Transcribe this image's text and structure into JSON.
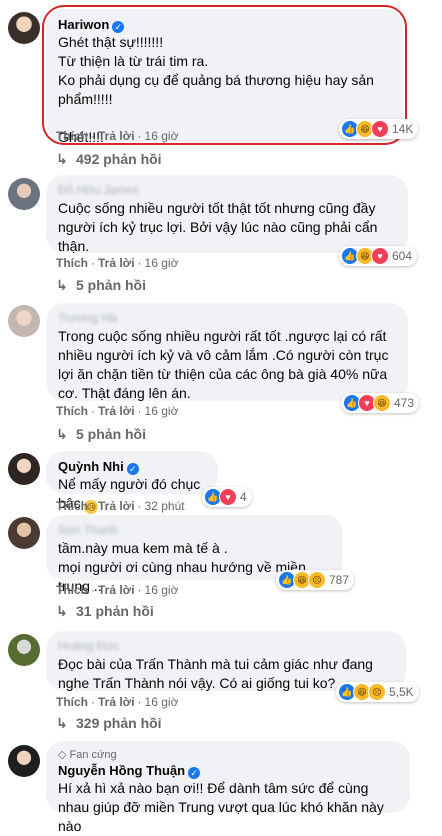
{
  "comments": [
    {
      "name": "Hariwon",
      "text": "Ghét thật sự!!!!!!!\nTừ thiện là từ trái tim ra.\nKo phải dụng cụ để quảng bá thương hiệu hay sản phẩm!!!!!\n\nGhét!!!!",
      "like": "Thích",
      "reply": "Trả lời",
      "time": "16 giờ",
      "reactions_count": "14K",
      "replies": "492 phản hồi"
    },
    {
      "name": "Đỗ Hữu James",
      "text": "Cuộc sống nhiều người tốt thật tốt nhưng cũng đầy người ích kỷ trục lợi. Bởi vậy lúc nào cũng phải cẩn thận.",
      "like": "Thích",
      "reply": "Trả lời",
      "time": "16 giờ",
      "reactions_count": "604",
      "replies": "5 phản hồi"
    },
    {
      "name": "Trương Hà",
      "text": "Trong cuộc sống nhiều người rất tốt .ngược lại có rất nhiều người ích kỷ và vô cảm lắm .Có người còn trục lợi ăn chặn tiền từ thiện của các ông bà già 40% nữa cơ. Thật đáng lên án.",
      "like": "Thích",
      "reply": "Trả lời",
      "time": "16 giờ",
      "reactions_count": "473",
      "replies": "5 phản hồi"
    },
    {
      "name": "Quỳnh Nhi",
      "text": "Nể mấy người đó chục bậc",
      "like": "Thích",
      "reply": "Trả lời",
      "time": "32 phút",
      "reactions_count": "4"
    },
    {
      "name": "Sơn Thanh",
      "text": "tầm.này mua kem mà tế à .\nmọi người ơi cùng nhau hướng về miền trung ..",
      "like": "Thích",
      "reply": "Trả lời",
      "time": "16 giờ",
      "reactions_count": "787",
      "replies": "31 phản hồi"
    },
    {
      "name": "Hoàng Đức",
      "text": "Đọc bài của Trấn Thành mà tui cảm giác như đang nghe Trấn Thành nói vậy. Có ai giống tui ko?",
      "like": "Thích",
      "reply": "Trả lời",
      "time": "16 giờ",
      "reactions_count": "5,5K",
      "replies": "329 phản hồi"
    },
    {
      "badge": "Fan cứng",
      "name": "Nguyễn Hồng Thuận",
      "text": "Hí xả hì xả nào bạn ơi!! Để dành tâm sức để cùng nhau giúp đỡ miền Trung vượt qua lúc khó khăn này nào"
    }
  ],
  "colors": {
    "highlight": "#d4252a",
    "bubble": "#f0f2f5",
    "like": "#1877f2",
    "love": "#f33e58",
    "haha": "#f7b928"
  }
}
